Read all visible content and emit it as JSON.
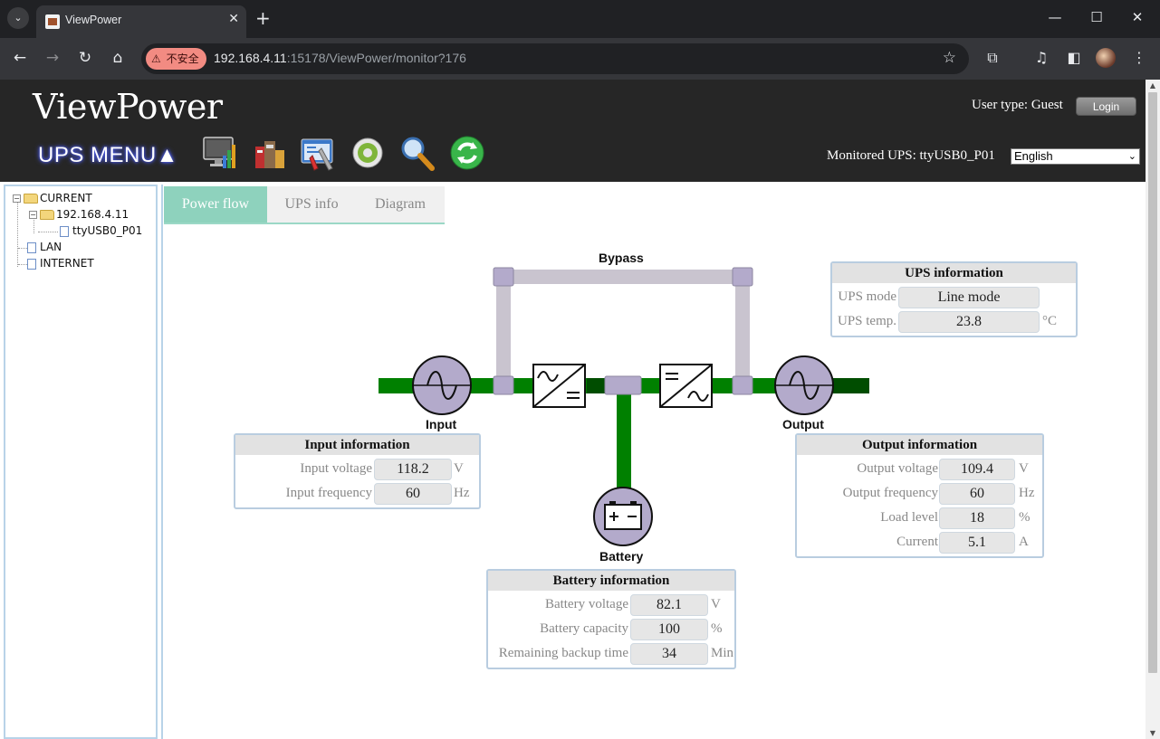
{
  "browser": {
    "tab_title": "ViewPower",
    "tab_close": "✕",
    "new_tab": "+",
    "insecure_label": "不安全",
    "url_host": "192.168.4.11",
    "url_rest": ":15178/ViewPower/monitor?176"
  },
  "header": {
    "brand": "ViewPower",
    "menu_label": "UPS MENU▲",
    "user_type": "User type: Guest",
    "login_label": "Login",
    "monitored": "Monitored UPS: ttyUSB0_P01",
    "language": "English"
  },
  "tree": {
    "root": "CURRENT",
    "host": "192.168.4.11",
    "device": "ttyUSB0_P01",
    "lan": "LAN",
    "internet": "INTERNET"
  },
  "tabs": [
    "Power flow",
    "UPS info",
    "Diagram"
  ],
  "flow": {
    "bypass": "Bypass",
    "input": "Input",
    "output": "Output",
    "battery": "Battery",
    "colors": {
      "line": "#008000",
      "line_dark": "#004d00",
      "bypass": "#c9c4cf",
      "node": "#b3aacb"
    }
  },
  "ups_info": {
    "title": "UPS information",
    "mode_label": "UPS mode",
    "mode_value": "Line mode",
    "temp_label": "UPS temp.",
    "temp_value": "23.8",
    "temp_unit": "°C"
  },
  "input_info": {
    "title": "Input information",
    "voltage_label": "Input voltage",
    "voltage_value": "118.2",
    "voltage_unit": "V",
    "freq_label": "Input frequency",
    "freq_value": "60",
    "freq_unit": "Hz"
  },
  "output_info": {
    "title": "Output information",
    "voltage_label": "Output voltage",
    "voltage_value": "109.4",
    "voltage_unit": "V",
    "freq_label": "Output frequency",
    "freq_value": "60",
    "freq_unit": "Hz",
    "load_label": "Load level",
    "load_value": "18",
    "load_unit": "%",
    "current_label": "Current",
    "current_value": "5.1",
    "current_unit": "A"
  },
  "battery_info": {
    "title": "Battery information",
    "voltage_label": "Battery voltage",
    "voltage_value": "82.1",
    "voltage_unit": "V",
    "capacity_label": "Battery capacity",
    "capacity_value": "100",
    "capacity_unit": "%",
    "backup_label": "Remaining backup time",
    "backup_value": "34",
    "backup_unit": "Min"
  }
}
